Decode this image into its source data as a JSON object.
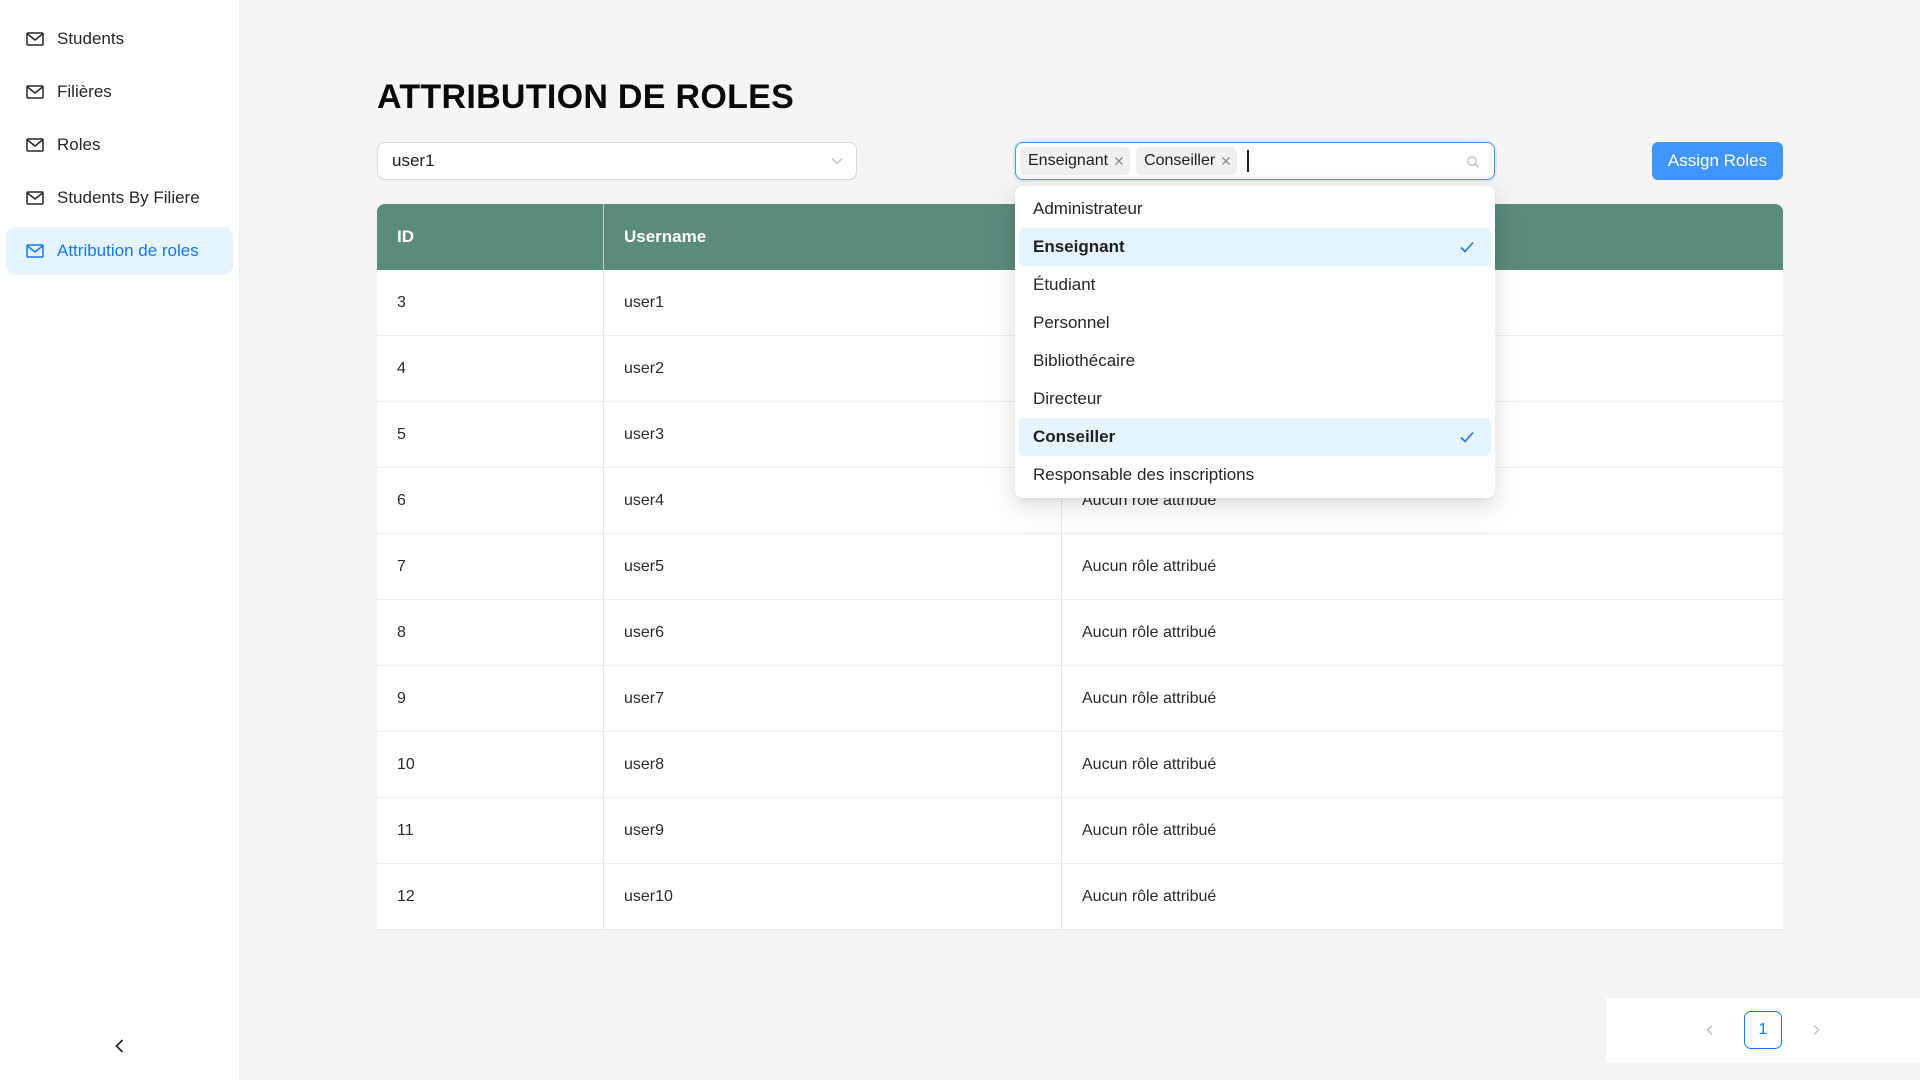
{
  "sidebar": {
    "items": [
      {
        "label": "Students",
        "icon": "mail-icon"
      },
      {
        "label": "Filières",
        "icon": "mail-icon"
      },
      {
        "label": "Roles",
        "icon": "mail-icon"
      },
      {
        "label": "Students By Filiere",
        "icon": "mail-icon"
      },
      {
        "label": "Attribution de roles",
        "icon": "mail-icon",
        "active": true
      }
    ],
    "collapse_icon": "chevron-left-icon"
  },
  "page": {
    "title": "ATTRIBUTION DE ROLES"
  },
  "user_select": {
    "value": "user1"
  },
  "role_select": {
    "tags": [
      "Enseignant",
      "Conseiller"
    ],
    "options": [
      {
        "label": "Administrateur",
        "selected": false
      },
      {
        "label": "Enseignant",
        "selected": true
      },
      {
        "label": "Étudiant",
        "selected": false
      },
      {
        "label": "Personnel",
        "selected": false
      },
      {
        "label": "Bibliothécaire",
        "selected": false
      },
      {
        "label": "Directeur",
        "selected": false
      },
      {
        "label": "Conseiller",
        "selected": true
      },
      {
        "label": "Responsable des inscriptions",
        "selected": false
      }
    ]
  },
  "assign_button": {
    "label": "Assign Roles"
  },
  "table": {
    "headers": [
      "ID",
      "Username",
      ""
    ],
    "rows": [
      [
        "3",
        "user1",
        ""
      ],
      [
        "4",
        "user2",
        ""
      ],
      [
        "5",
        "user3",
        ""
      ],
      [
        "6",
        "user4",
        "Aucun rôle attribué"
      ],
      [
        "7",
        "user5",
        "Aucun rôle attribué"
      ],
      [
        "8",
        "user6",
        "Aucun rôle attribué"
      ],
      [
        "9",
        "user7",
        "Aucun rôle attribué"
      ],
      [
        "10",
        "user8",
        "Aucun rôle attribué"
      ],
      [
        "11",
        "user9",
        "Aucun rôle attribué"
      ],
      [
        "12",
        "user10",
        "Aucun rôle attribué"
      ]
    ]
  },
  "pagination": {
    "current": "1"
  },
  "colors": {
    "accent": "#1677ff",
    "header": "#5b8b7d",
    "button": "#4096ff",
    "active_bg": "#e6f4ff"
  }
}
